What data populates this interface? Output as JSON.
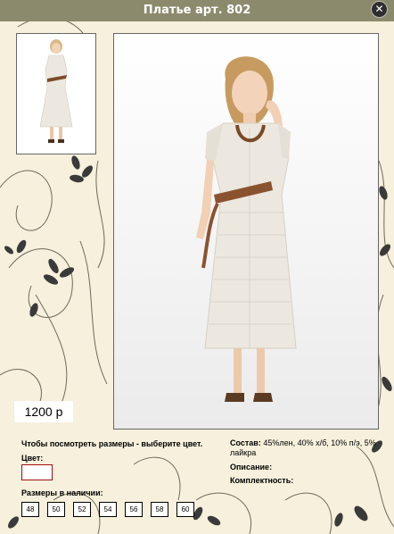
{
  "window": {
    "title": "Платье арт. 802",
    "close_symbol": "✕"
  },
  "product": {
    "price": "1200 р",
    "sizes_prompt": "Чтобы посмотреть размеры - выберите цвет.",
    "color_label": "Цвет:",
    "sizes_label": "Размеры в наличии:",
    "sizes": [
      "48",
      "50",
      "52",
      "54",
      "56",
      "58",
      "60"
    ],
    "composition_label": "Состав:",
    "composition_value": "45%лен, 40% х/б, 10% п/э, 5% лайкра",
    "description_label": "Описание:",
    "set_label": "Комплектность:"
  },
  "colors": {
    "header": "#8c8a6d",
    "background": "#f6f0dc",
    "ornament": "#3a3a3a",
    "dress": "#ece8df"
  }
}
